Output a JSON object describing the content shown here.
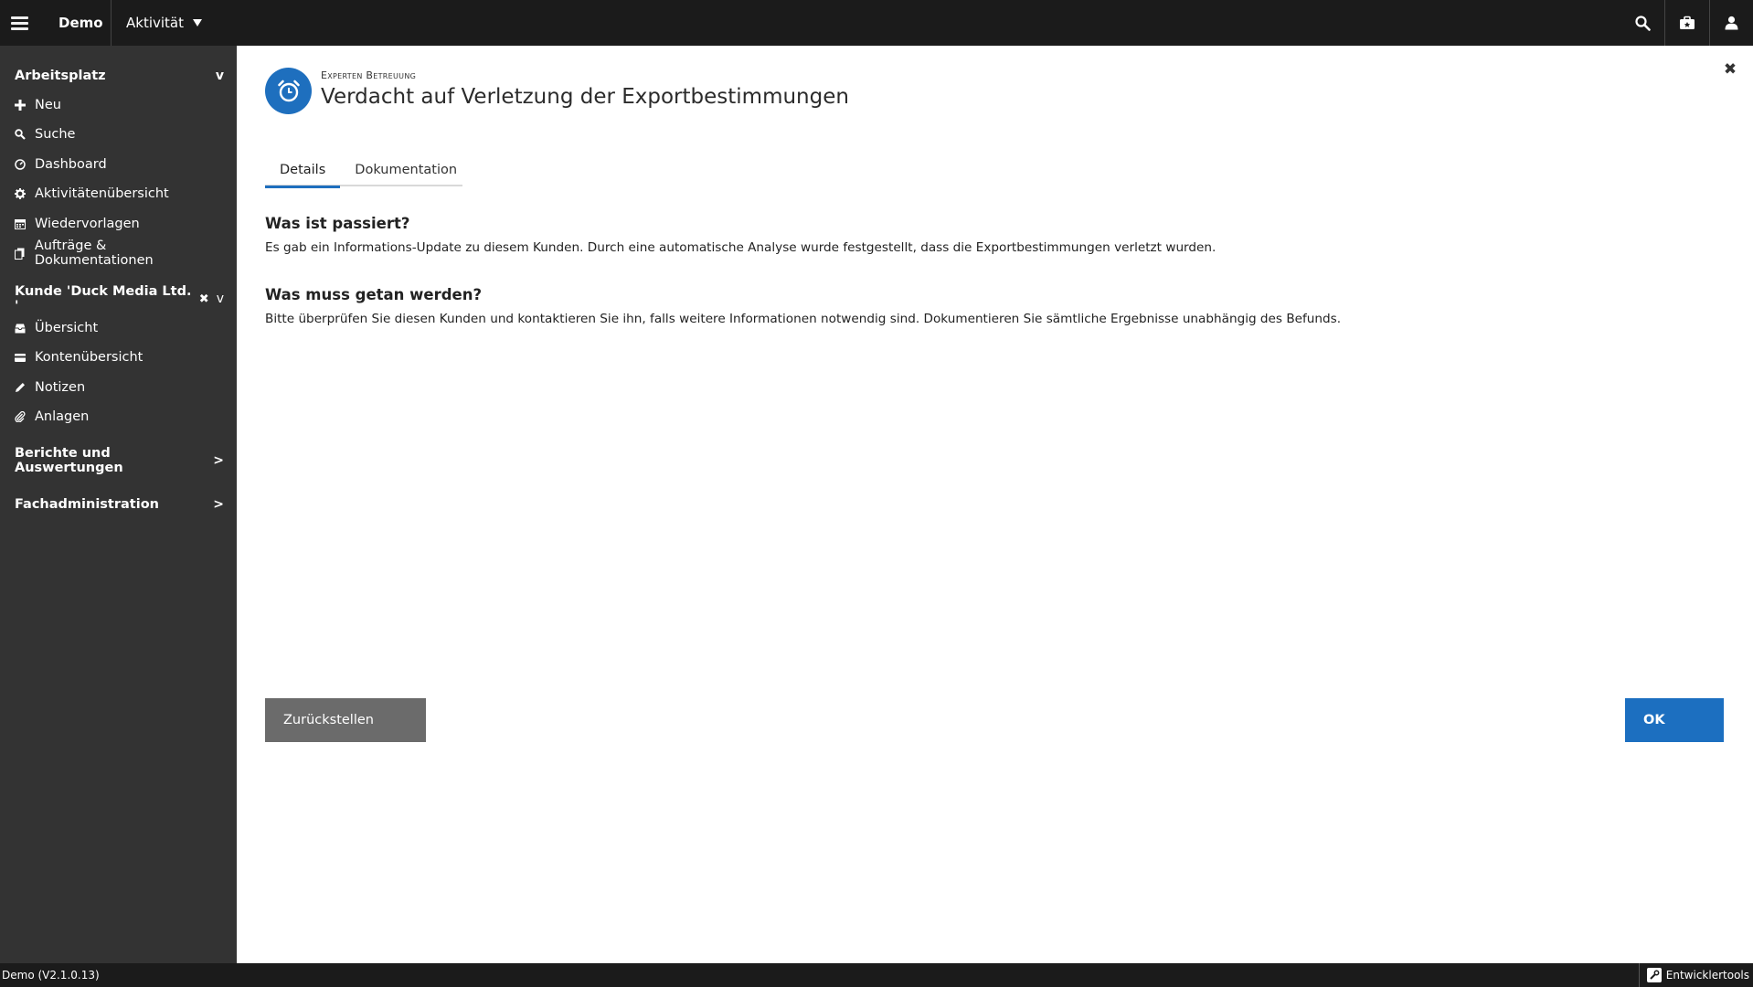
{
  "header": {
    "app_name": "Demo",
    "activity_label": "Aktivität"
  },
  "sidebar": {
    "workspace": {
      "title": "Arbeitsplatz",
      "items": [
        {
          "label": "Neu",
          "icon": "plus-icon"
        },
        {
          "label": "Suche",
          "icon": "search-icon"
        },
        {
          "label": "Dashboard",
          "icon": "dashboard-icon"
        },
        {
          "label": "Aktivitätenübersicht",
          "icon": "gear-icon"
        },
        {
          "label": "Wiedervorlagen",
          "icon": "calendar-icon"
        },
        {
          "label": "Aufträge & Dokumentationen",
          "icon": "documents-icon"
        }
      ]
    },
    "customer": {
      "title": "Kunde 'Duck Media Ltd. '",
      "items": [
        {
          "label": "Übersicht",
          "icon": "inbox-icon"
        },
        {
          "label": "Kontenübersicht",
          "icon": "card-icon"
        },
        {
          "label": "Notizen",
          "icon": "pencil-icon"
        },
        {
          "label": "Anlagen",
          "icon": "paperclip-icon"
        }
      ]
    },
    "reports": {
      "title": "Berichte und Auswertungen"
    },
    "admin": {
      "title": "Fachadministration"
    }
  },
  "main": {
    "kicker": "Experten Betreuung",
    "title": "Verdacht auf Verletzung der Exportbestimmungen",
    "tabs": [
      {
        "label": "Details"
      },
      {
        "label": "Dokumentation"
      }
    ],
    "section1": {
      "heading": "Was ist passiert?",
      "text": "Es gab ein Informations-Update zu diesem Kunden. Durch eine automatische Analyse wurde festgestellt, dass die Exportbestimmungen verletzt wurden."
    },
    "section2": {
      "heading": "Was muss getan werden?",
      "text": "Bitte überprüfen Sie diesen Kunden und kontaktieren Sie ihn, falls weitere Informationen notwendig sind. Dokumentieren Sie sämtliche Ergebnisse unabhängig des Befunds."
    },
    "defer_label": "Zurückstellen",
    "ok_label": "OK"
  },
  "statusbar": {
    "version": "Demo (V2.1.0.13)",
    "devtools": "Entwicklertools"
  },
  "colors": {
    "accent": "#1e6fbe",
    "topbar": "#1b1b1b",
    "sidebar": "#333333"
  }
}
